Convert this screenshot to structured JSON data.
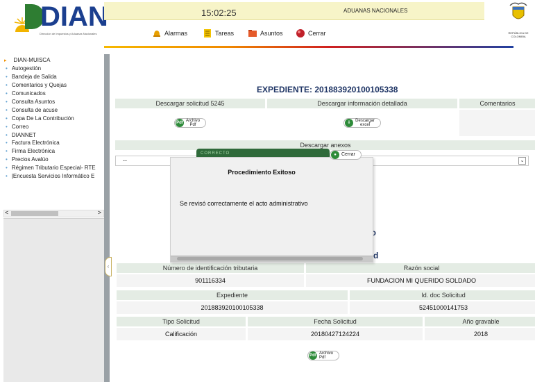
{
  "header": {
    "brand": "DIAN",
    "brand_subtitle": "Dirección de Impuestos y Aduanas Nacionales",
    "clock": "15:02:25",
    "banner": "ADUANAS NACIONALES",
    "nav": [
      {
        "label": "Alarmas",
        "icon": "warning-bell-icon",
        "color": "#e8a000"
      },
      {
        "label": "Tareas",
        "icon": "task-list-icon",
        "color": "#f2c200"
      },
      {
        "label": "Asuntos",
        "icon": "folder-icon",
        "color": "#e55a2a"
      },
      {
        "label": "Cerrar",
        "icon": "power-icon",
        "color": "#c0202a"
      }
    ],
    "republic": "REPÚBLICA DE COLOMBIA"
  },
  "sidebar": {
    "root": "DIAN-MUISCA",
    "items": [
      "Autogestión",
      "Bandeja de Salida",
      "Comentarios y Quejas",
      "Comunicados",
      "Consulta Asuntos",
      "Consulta de acuse",
      "Copa De La Contribución",
      "Correo",
      "DIANNET",
      "Factura Electrónica",
      "Firma Electrónica",
      "Precios Avalúo",
      "Régimen Tributario Especial- RTE",
      "|Encuesta Servicios Informático E"
    ],
    "scroll_left": "<",
    "scroll_right": ">",
    "collapse": "‹"
  },
  "main": {
    "title": "EXPEDIENTE: 201883920100105338",
    "downloads": {
      "headers": [
        "Descargar solicitud 5245",
        "Descargar información detallada",
        "Comentarios"
      ],
      "pdf_button": {
        "badge": "Pdf",
        "line1": "Archivo",
        "line2": "Pdf"
      },
      "excel_button": {
        "line1": "Descargar",
        "line2": "excel"
      }
    },
    "anexos_header": "Descargar anexos",
    "anexos_select": "--",
    "partial_text_1": "vo",
    "partial_text_2": "d",
    "info1": {
      "headers": [
        "Número de identificación tributaria",
        "Razón social"
      ],
      "values": [
        "901116334",
        "FUNDACION MI QUERIDO SOLDADO"
      ]
    },
    "info2": {
      "headers": [
        "Expediente",
        "Id. doc Solicitud"
      ],
      "values": [
        "201883920100105338",
        "52451000141753"
      ]
    },
    "info3": {
      "headers": [
        "Tipo Solicitud",
        "Fecha Solicitud",
        "Año gravable"
      ],
      "values": [
        "Calificación",
        "20180427124224",
        "2018"
      ]
    },
    "bottom_pdf": {
      "badge": "Pdf",
      "line1": "Archivo",
      "line2": "Pdf"
    }
  },
  "dialog": {
    "tab_label": "CORRECTO",
    "title": "Procedimiento Exitoso",
    "message": "Se revisó correctamente el acto administrativo",
    "close_label": "Cerrar"
  }
}
